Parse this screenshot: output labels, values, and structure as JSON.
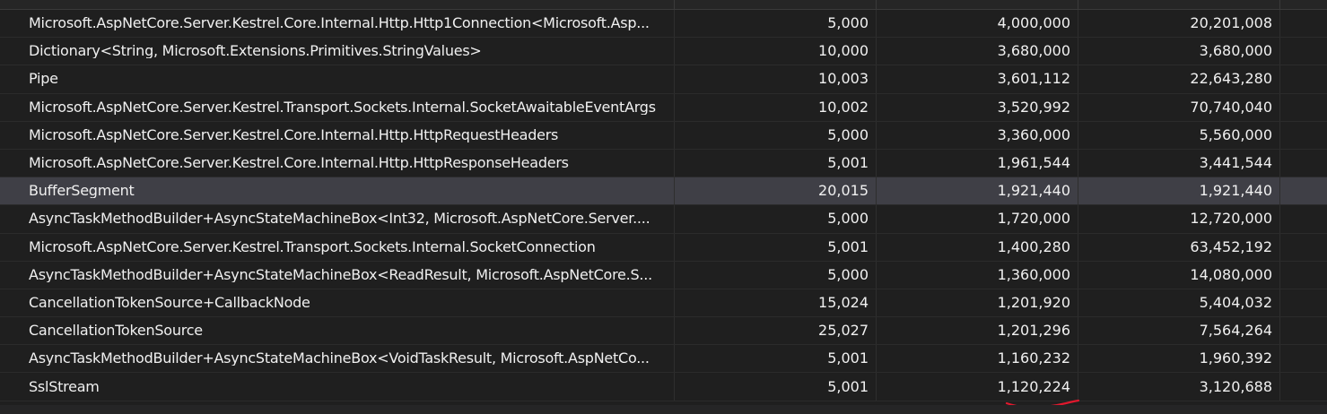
{
  "table": {
    "rows": [
      {
        "name": "Microsoft.AspNetCore.Server.Kestrel.Core.Internal.Http.Http1Connection<Microsoft.Asp...",
        "count": "5,000",
        "size": "4,000,000",
        "inclusive": "20,201,008"
      },
      {
        "name": "Dictionary<String, Microsoft.Extensions.Primitives.StringValues>",
        "count": "10,000",
        "size": "3,680,000",
        "inclusive": "3,680,000"
      },
      {
        "name": "Pipe",
        "count": "10,003",
        "size": "3,601,112",
        "inclusive": "22,643,280"
      },
      {
        "name": "Microsoft.AspNetCore.Server.Kestrel.Transport.Sockets.Internal.SocketAwaitableEventArgs",
        "count": "10,002",
        "size": "3,520,992",
        "inclusive": "70,740,040"
      },
      {
        "name": "Microsoft.AspNetCore.Server.Kestrel.Core.Internal.Http.HttpRequestHeaders",
        "count": "5,000",
        "size": "3,360,000",
        "inclusive": "5,560,000"
      },
      {
        "name": "Microsoft.AspNetCore.Server.Kestrel.Core.Internal.Http.HttpResponseHeaders",
        "count": "5,001",
        "size": "1,961,544",
        "inclusive": "3,441,544"
      },
      {
        "name": "BufferSegment",
        "count": "20,015",
        "size": "1,921,440",
        "inclusive": "1,921,440"
      },
      {
        "name": "AsyncTaskMethodBuilder+AsyncStateMachineBox<Int32, Microsoft.AspNetCore.Server....",
        "count": "5,000",
        "size": "1,720,000",
        "inclusive": "12,720,000"
      },
      {
        "name": "Microsoft.AspNetCore.Server.Kestrel.Transport.Sockets.Internal.SocketConnection",
        "count": "5,001",
        "size": "1,400,280",
        "inclusive": "63,452,192"
      },
      {
        "name": "AsyncTaskMethodBuilder+AsyncStateMachineBox<ReadResult, Microsoft.AspNetCore.S...",
        "count": "5,000",
        "size": "1,360,000",
        "inclusive": "14,080,000"
      },
      {
        "name": "CancellationTokenSource+CallbackNode",
        "count": "15,024",
        "size": "1,201,920",
        "inclusive": "5,404,032"
      },
      {
        "name": "CancellationTokenSource",
        "count": "25,027",
        "size": "1,201,296",
        "inclusive": "7,564,264"
      },
      {
        "name": "AsyncTaskMethodBuilder+AsyncStateMachineBox<VoidTaskResult, Microsoft.AspNetCo...",
        "count": "5,001",
        "size": "1,160,232",
        "inclusive": "1,960,392"
      },
      {
        "name": "SslStream",
        "count": "5,001",
        "size": "1,120,224",
        "inclusive": "3,120,688"
      }
    ],
    "selected_index": 6
  },
  "colors": {
    "background": "#1f1f1f",
    "selected_row": "#3f3f46",
    "text": "#f0f0f0",
    "annotation": "#e0182d"
  }
}
